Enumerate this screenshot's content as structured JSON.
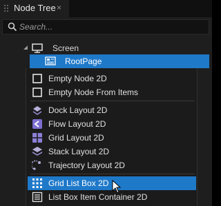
{
  "panel": {
    "tab_title": "Node Tree",
    "close_glyph": "×",
    "grip_icon": "grip-icon"
  },
  "search": {
    "placeholder": "Search...",
    "value": ""
  },
  "tree": {
    "screen_label": "Screen",
    "root_label": "RootPage",
    "selected": "RootPage"
  },
  "menu": {
    "group1": [
      {
        "label": "Empty Node 2D",
        "icon": "empty-node-icon"
      },
      {
        "label": "Empty Node From Items",
        "icon": "empty-node-icon"
      }
    ],
    "group2": [
      {
        "label": "Dock Layout 2D",
        "icon": "dock-layout-icon"
      },
      {
        "label": "Flow Layout 2D",
        "icon": "flow-layout-icon"
      },
      {
        "label": "Grid Layout 2D",
        "icon": "grid-layout-icon"
      },
      {
        "label": "Stack Layout 2D",
        "icon": "stack-layout-icon"
      },
      {
        "label": "Trajectory Layout 2D",
        "icon": "trajectory-layout-icon"
      }
    ],
    "group3": [
      {
        "label": "Grid List Box 2D",
        "icon": "grid-list-box-icon",
        "highlighted": true
      },
      {
        "label": "List Box Item Container 2D",
        "icon": "list-box-item-icon"
      }
    ]
  },
  "colors": {
    "accent": "#1f79c9",
    "panel_bg": "#1e1e1e",
    "menu_bg": "#1b1b1b",
    "text": "#e0e0e0"
  }
}
